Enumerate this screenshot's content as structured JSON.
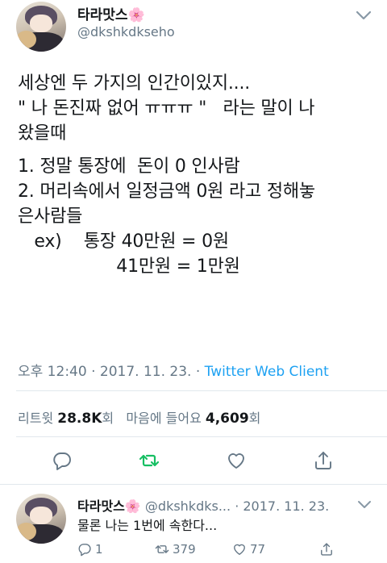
{
  "tweet": {
    "author_name": "타라맛스",
    "author_emoji": "🌸",
    "handle": "@dkshkdkseho",
    "lines": [
      "세상엔 두 가지의 인간이있지....",
      "\" 나 돈진짜 없어 ㅠㅠㅠ \"   라는 말이 나",
      "왔을때",
      "1. 정말 통장에  돈이 0 인사람",
      "2. 머리속에서 일정금액 0원 라고 정해놓",
      "은사람들",
      "   ex)    통장 40만원 = 0원",
      "                  41만원 = 1만원"
    ],
    "time": "오후 12:40",
    "date": "2017. 11. 23.",
    "separator": "·",
    "client": "Twitter Web Client",
    "retweets_label": "리트윗",
    "retweets_value": "28.8K",
    "retweets_unit": "회",
    "likes_label": "마음에 들어요",
    "likes_value": "4,609",
    "likes_unit": "회"
  },
  "reply": {
    "author_name": "타라맛스",
    "author_emoji": "🌸",
    "handle": "@dkshkdks...",
    "separator": "·",
    "date": "2017. 11. 23.",
    "text": "물론 나는 1번에 속한다...",
    "reply_count": "1",
    "retweet_count": "379",
    "like_count": "77"
  },
  "icons": {
    "reply": "reply-icon",
    "retweet": "retweet-icon",
    "like": "heart-icon",
    "share": "share-icon",
    "menu": "chevron-down-icon"
  },
  "colors": {
    "accent": "#1da1f2",
    "retweet_green": "#17bf63",
    "muted": "#657786",
    "text": "#14171a",
    "divider": "#e1e8ed"
  }
}
